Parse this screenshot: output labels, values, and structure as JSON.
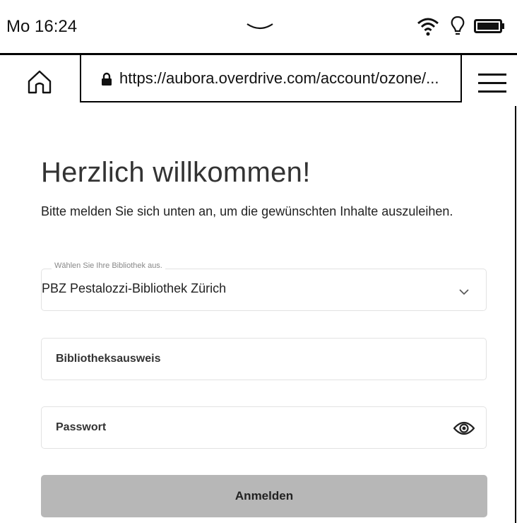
{
  "status": {
    "time": "Mo 16:24"
  },
  "browser": {
    "url": "https://aubora.overdrive.com/account/ozone/..."
  },
  "content": {
    "heading": "Herzlich willkommen!",
    "intro": "Bitte melden Sie sich unten an, um die gewünschten Inhalte auszuleihen.",
    "library_select": {
      "label": "Wählen Sie Ihre Bibliothek aus.",
      "value": "PBZ Pestalozzi-Bibliothek Zürich"
    },
    "card_field": {
      "placeholder": "Bibliotheksausweis"
    },
    "password_field": {
      "placeholder": "Passwort"
    },
    "submit_label": "Anmelden"
  }
}
